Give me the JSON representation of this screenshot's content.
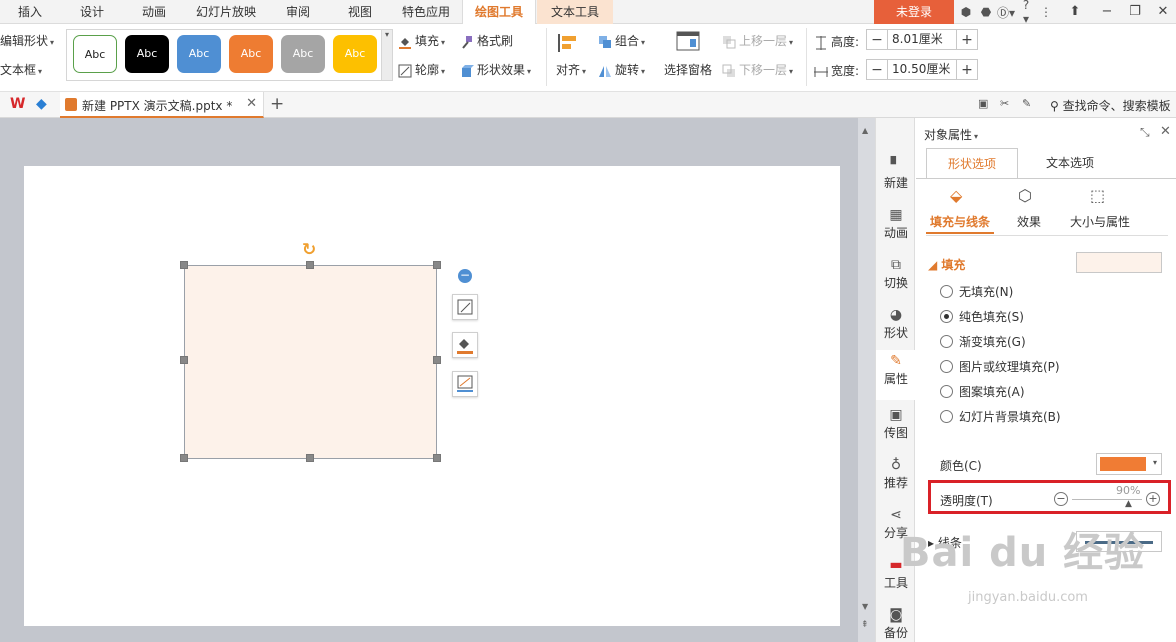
{
  "menu": {
    "tabs": [
      "插入",
      "设计",
      "动画",
      "幻灯片放映",
      "审阅",
      "视图",
      "特色应用",
      "绘图工具",
      "文本工具"
    ],
    "active_tab": "绘图工具",
    "login": "未登录",
    "help": "?"
  },
  "ribbon": {
    "edit_shape": "编辑形状",
    "textbox": "文本框",
    "style_sample": "Abc",
    "fill": "填充",
    "outline": "轮廓",
    "format_painter": "格式刷",
    "shape_effect": "形状效果",
    "align": "对齐",
    "group": "组合",
    "rotate": "旋转",
    "selection_pane": "选择窗格",
    "bring_forward": "上移一层",
    "send_backward": "下移一层",
    "height_label": "高度:",
    "height_value": "8.01厘米",
    "width_label": "宽度:",
    "width_value": "10.50厘米"
  },
  "doc": {
    "tab_title": "新建 PPTX 演示文稿.pptx *",
    "search": "查找命令、搜索模板"
  },
  "sidebar": {
    "items": [
      "新建",
      "动画",
      "切换",
      "形状",
      "属性",
      "传图",
      "推荐",
      "分享",
      "工具",
      "备份"
    ]
  },
  "panel": {
    "title": "对象属性",
    "tab_shape": "形状选项",
    "tab_text": "文本选项",
    "sub_fill_line": "填充与线条",
    "sub_effect": "效果",
    "sub_size": "大小与属性",
    "fill_section": "填充",
    "options": [
      "无填充(N)",
      "纯色填充(S)",
      "渐变填充(G)",
      "图片或纹理填充(P)",
      "图案填充(A)",
      "幻灯片背景填充(B)"
    ],
    "color_label": "颜色(C)",
    "transparency_label": "透明度(T)",
    "transparency_value": "90%",
    "line_section": "线条"
  },
  "colors": {
    "accent": "#e07a2e",
    "shape_fill": "#fdf2ea",
    "color_swatch": "#f07c34",
    "highlight_box": "#d92128"
  },
  "watermark": {
    "text": "Bai du 经验",
    "url": "jingyan.baidu.com"
  }
}
